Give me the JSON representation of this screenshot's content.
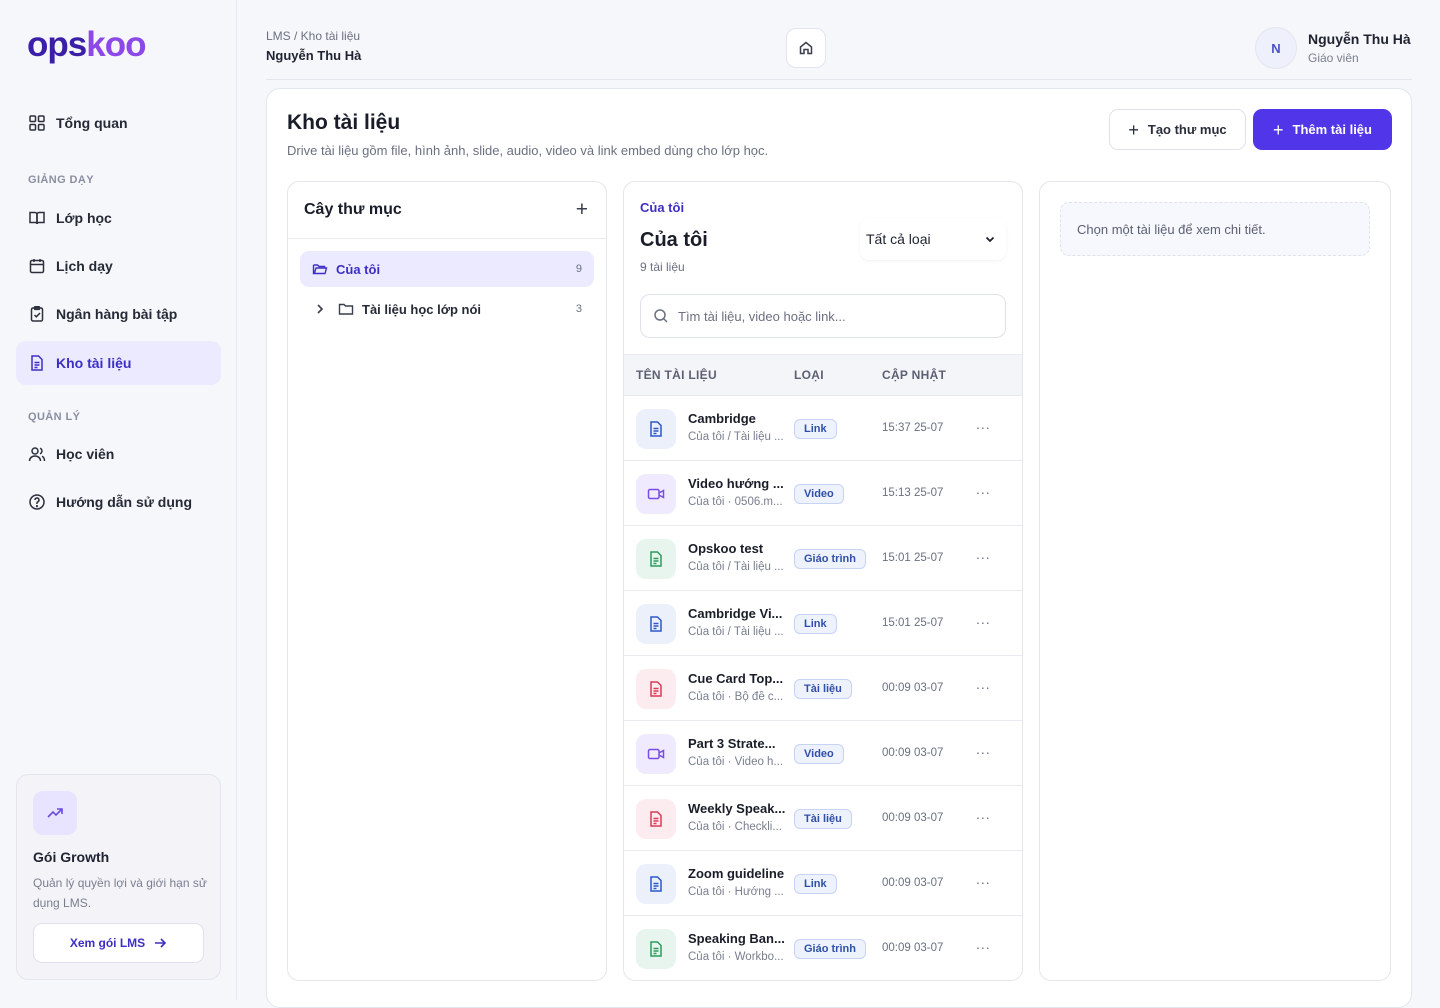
{
  "brand": {
    "logo_part1": "ops",
    "logo_part2": "koo"
  },
  "sidebar": {
    "overview": "Tổng quan",
    "section_teaching": "GIẢNG DẠY",
    "teaching": [
      {
        "label": "Lớp học",
        "icon": "book-icon"
      },
      {
        "label": "Lịch dạy",
        "icon": "calendar-icon"
      },
      {
        "label": "Ngân hàng bài tập",
        "icon": "clipboard-icon"
      },
      {
        "label": "Kho tài liệu",
        "icon": "document-icon",
        "active": true
      }
    ],
    "section_manage": "QUẢN LÝ",
    "manage": [
      {
        "label": "Học viên",
        "icon": "users-icon"
      },
      {
        "label": "Hướng dẫn sử dụng",
        "icon": "help-icon"
      }
    ],
    "promo": {
      "title": "Gói Growth",
      "description": "Quản lý quyền lợi và giới hạn sử dụng LMS.",
      "button": "Xem gói LMS"
    }
  },
  "header": {
    "breadcrumb": "LMS / Kho tài liệu",
    "title": "Nguyễn Thu Hà",
    "user": {
      "initial": "N",
      "name": "Nguyễn Thu Hà",
      "role": "Giáo viên"
    }
  },
  "page": {
    "title": "Kho tài liệu",
    "subtitle": "Drive tài liệu gồm file, hình ảnh, slide, audio, video và link embed dùng cho lớp học.",
    "create_folder": "Tạo thư mục",
    "add_document": "Thêm tài liệu"
  },
  "tree": {
    "title": "Cây thư mục",
    "root": {
      "label": "Của tôi",
      "count": "9"
    },
    "children": [
      {
        "label": "Tài liệu học lớp nói",
        "count": "3"
      }
    ]
  },
  "docs": {
    "eyebrow": "Của tôi",
    "title": "Của tôi",
    "count": "9 tài liệu",
    "filter": "Tất cả loại",
    "search_placeholder": "Tìm tài liệu, video hoặc link...",
    "columns": {
      "name": "TÊN TÀI LIỆU",
      "type": "LOẠI",
      "updated": "CẬP NHẬT"
    },
    "rows": [
      {
        "name": "Cambridge",
        "path": "Của tôi / Tài liệu ...",
        "type": "Link",
        "time": "15:37 25-07",
        "icon": "link"
      },
      {
        "name": "Video hướng ...",
        "path": "Của tôi · 0506.m...",
        "type": "Video",
        "time": "15:13 25-07",
        "icon": "video"
      },
      {
        "name": "Opskoo test",
        "path": "Của tôi / Tài liệu ...",
        "type": "Giáo trình",
        "time": "15:01 25-07",
        "icon": "green"
      },
      {
        "name": "Cambridge Vi...",
        "path": "Của tôi / Tài liệu ...",
        "type": "Link",
        "time": "15:01 25-07",
        "icon": "link"
      },
      {
        "name": "Cue Card Top...",
        "path": "Của tôi · Bộ đề c...",
        "type": "Tài liệu",
        "time": "00:09 03-07",
        "icon": "red"
      },
      {
        "name": "Part 3 Strate...",
        "path": "Của tôi · Video h...",
        "type": "Video",
        "time": "00:09 03-07",
        "icon": "video"
      },
      {
        "name": "Weekly Speak...",
        "path": "Của tôi · Checkli...",
        "type": "Tài liệu",
        "time": "00:09 03-07",
        "icon": "red"
      },
      {
        "name": "Zoom guideline",
        "path": "Của tôi · Hướng ...",
        "type": "Link",
        "time": "00:09 03-07",
        "icon": "link"
      },
      {
        "name": "Speaking Ban...",
        "path": "Của tôi · Workbo...",
        "type": "Giáo trình",
        "time": "00:09 03-07",
        "icon": "green"
      }
    ],
    "more_label": "..."
  },
  "detail": {
    "empty": "Chọn một tài liệu để xem chi tiết."
  }
}
